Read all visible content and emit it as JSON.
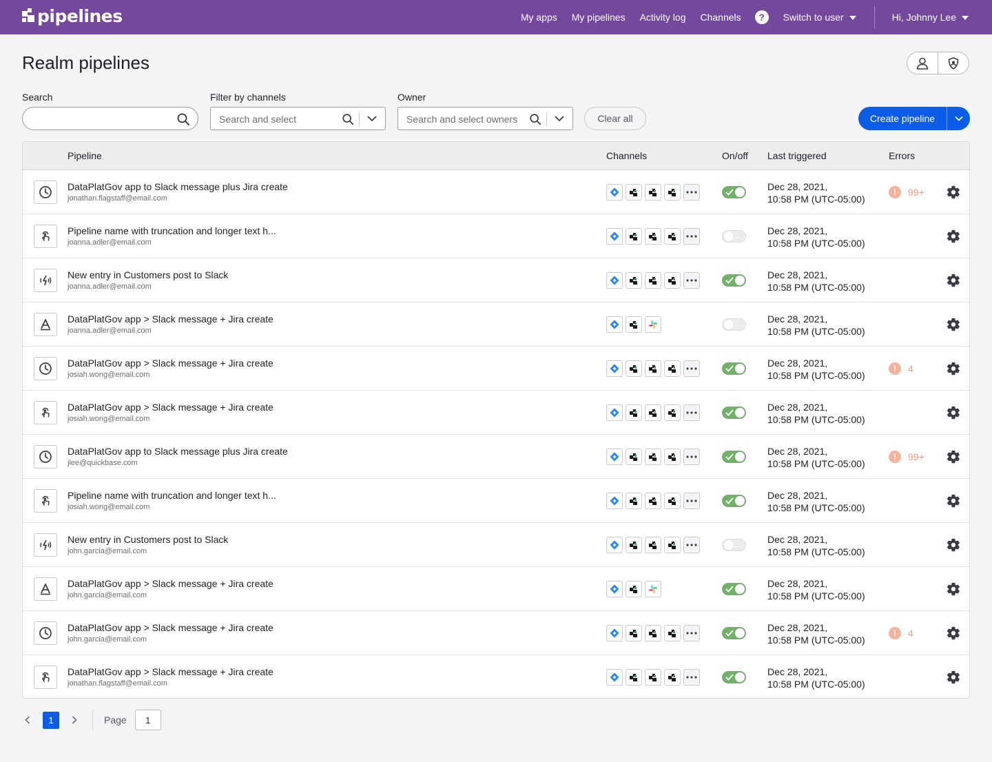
{
  "app": {
    "logo_text": "pipelines",
    "brand_color": "#74489d",
    "accent_color": "#0b5ce6"
  },
  "nav": {
    "my_apps": "My apps",
    "my_pipelines": "My pipelines",
    "activity_log": "Activity log",
    "channels": "Channels",
    "help_glyph": "?",
    "switch_user": "Switch to user",
    "user_greeting": "Hi, Johnny Lee"
  },
  "page": {
    "title": "Realm pipelines"
  },
  "filters": {
    "search_label": "Search",
    "search_value": "",
    "channels_label": "Filter by channels",
    "channels_placeholder": "Search and select",
    "owner_label": "Owner",
    "owner_placeholder": "Search and select owners",
    "clear_all": "Clear all",
    "create_pipeline": "Create pipeline"
  },
  "table": {
    "headers": {
      "pipeline": "Pipeline",
      "channels": "Channels",
      "on_off": "On/off",
      "last_triggered": "Last triggered",
      "errors": "Errors"
    },
    "rows": [
      {
        "trigger_icon": "clock-icon",
        "name": "DataPlatGov app to Slack message plus Jira create",
        "owner": "jonathan.flagstaff@email.com",
        "channels": [
          "jira-icon",
          "quickbase-icon",
          "quickbase-icon",
          "quickbase-icon",
          "more"
        ],
        "on": true,
        "date": "Dec 28, 2021,",
        "time": "10:58 PM (UTC-05:00)",
        "errors": "99+"
      },
      {
        "trigger_icon": "touch-icon",
        "name": "Pipeline name with truncation and longer text h...",
        "owner": "joanna.adler@email.com",
        "channels": [
          "jira-icon",
          "quickbase-icon",
          "quickbase-icon",
          "quickbase-icon",
          "more"
        ],
        "on": false,
        "date": "Dec 28, 2021,",
        "time": "10:58 PM (UTC-05:00)",
        "errors": ""
      },
      {
        "trigger_icon": "webhook-icon",
        "name": "New entry in Customers post to Slack",
        "owner": "joanna.adler@email.com",
        "channels": [
          "jira-icon",
          "quickbase-icon",
          "quickbase-icon",
          "quickbase-icon",
          "more"
        ],
        "on": true,
        "date": "Dec 28, 2021,",
        "time": "10:58 PM (UTC-05:00)",
        "errors": ""
      },
      {
        "trigger_icon": "text-icon",
        "name": "DataPlatGov app > Slack message + Jira create",
        "owner": "joanna.adler@email.com",
        "channels": [
          "jira-icon",
          "quickbase-icon",
          "slack-icon"
        ],
        "on": false,
        "date": "Dec 28, 2021,",
        "time": "10:58 PM (UTC-05:00)",
        "errors": ""
      },
      {
        "trigger_icon": "clock-icon",
        "name": "DataPlatGov app > Slack message + Jira create",
        "owner": "josiah.wong@email.com",
        "channels": [
          "jira-icon",
          "quickbase-icon",
          "quickbase-icon",
          "quickbase-icon",
          "more"
        ],
        "on": true,
        "date": "Dec 28, 2021,",
        "time": "10:58 PM (UTC-05:00)",
        "errors": "4"
      },
      {
        "trigger_icon": "touch-icon",
        "name": "DataPlatGov app > Slack message + Jira create",
        "owner": "josiah.wong@email.com",
        "channels": [
          "jira-icon",
          "quickbase-icon",
          "quickbase-icon",
          "quickbase-icon",
          "more"
        ],
        "on": true,
        "date": "Dec 28, 2021,",
        "time": "10:58 PM (UTC-05:00)",
        "errors": ""
      },
      {
        "trigger_icon": "clock-icon",
        "name": "DataPlatGov app to Slack message plus Jira create",
        "owner": "jlee@quickbase.com",
        "channels": [
          "jira-icon",
          "quickbase-icon",
          "quickbase-icon",
          "quickbase-icon",
          "more"
        ],
        "on": true,
        "date": "Dec 28, 2021,",
        "time": "10:58 PM (UTC-05:00)",
        "errors": "99+"
      },
      {
        "trigger_icon": "touch-icon",
        "name": "Pipeline name with truncation and longer text h...",
        "owner": "josiah.wong@email.com",
        "channels": [
          "jira-icon",
          "quickbase-icon",
          "quickbase-icon",
          "quickbase-icon",
          "more"
        ],
        "on": true,
        "date": "Dec 28, 2021,",
        "time": "10:58 PM (UTC-05:00)",
        "errors": ""
      },
      {
        "trigger_icon": "webhook-icon",
        "name": "New entry in Customers post to Slack",
        "owner": "john.garcia@email.com",
        "channels": [
          "jira-icon",
          "quickbase-icon",
          "quickbase-icon",
          "quickbase-icon",
          "more"
        ],
        "on": false,
        "date": "Dec 28, 2021,",
        "time": "10:58 PM (UTC-05:00)",
        "errors": ""
      },
      {
        "trigger_icon": "text-icon",
        "name": "DataPlatGov app > Slack message + Jira create",
        "owner": "john.garcia@email.com",
        "channels": [
          "jira-icon",
          "quickbase-icon",
          "slack-icon"
        ],
        "on": true,
        "date": "Dec 28, 2021,",
        "time": "10:58 PM (UTC-05:00)",
        "errors": ""
      },
      {
        "trigger_icon": "clock-icon",
        "name": "DataPlatGov app > Slack message + Jira create",
        "owner": "john.garcia@email.com",
        "channels": [
          "jira-icon",
          "quickbase-icon",
          "quickbase-icon",
          "quickbase-icon",
          "more"
        ],
        "on": true,
        "date": "Dec 28, 2021,",
        "time": "10:58 PM (UTC-05:00)",
        "errors": "4"
      },
      {
        "trigger_icon": "touch-icon",
        "name": "DataPlatGov app > Slack message + Jira create",
        "owner": "jonathan.flagstaff@email.com",
        "channels": [
          "jira-icon",
          "quickbase-icon",
          "quickbase-icon",
          "quickbase-icon",
          "more"
        ],
        "on": true,
        "date": "Dec 28, 2021,",
        "time": "10:58 PM (UTC-05:00)",
        "errors": ""
      }
    ]
  },
  "pagination": {
    "current_page": "1",
    "page_label": "Page",
    "page_input_value": "1"
  }
}
